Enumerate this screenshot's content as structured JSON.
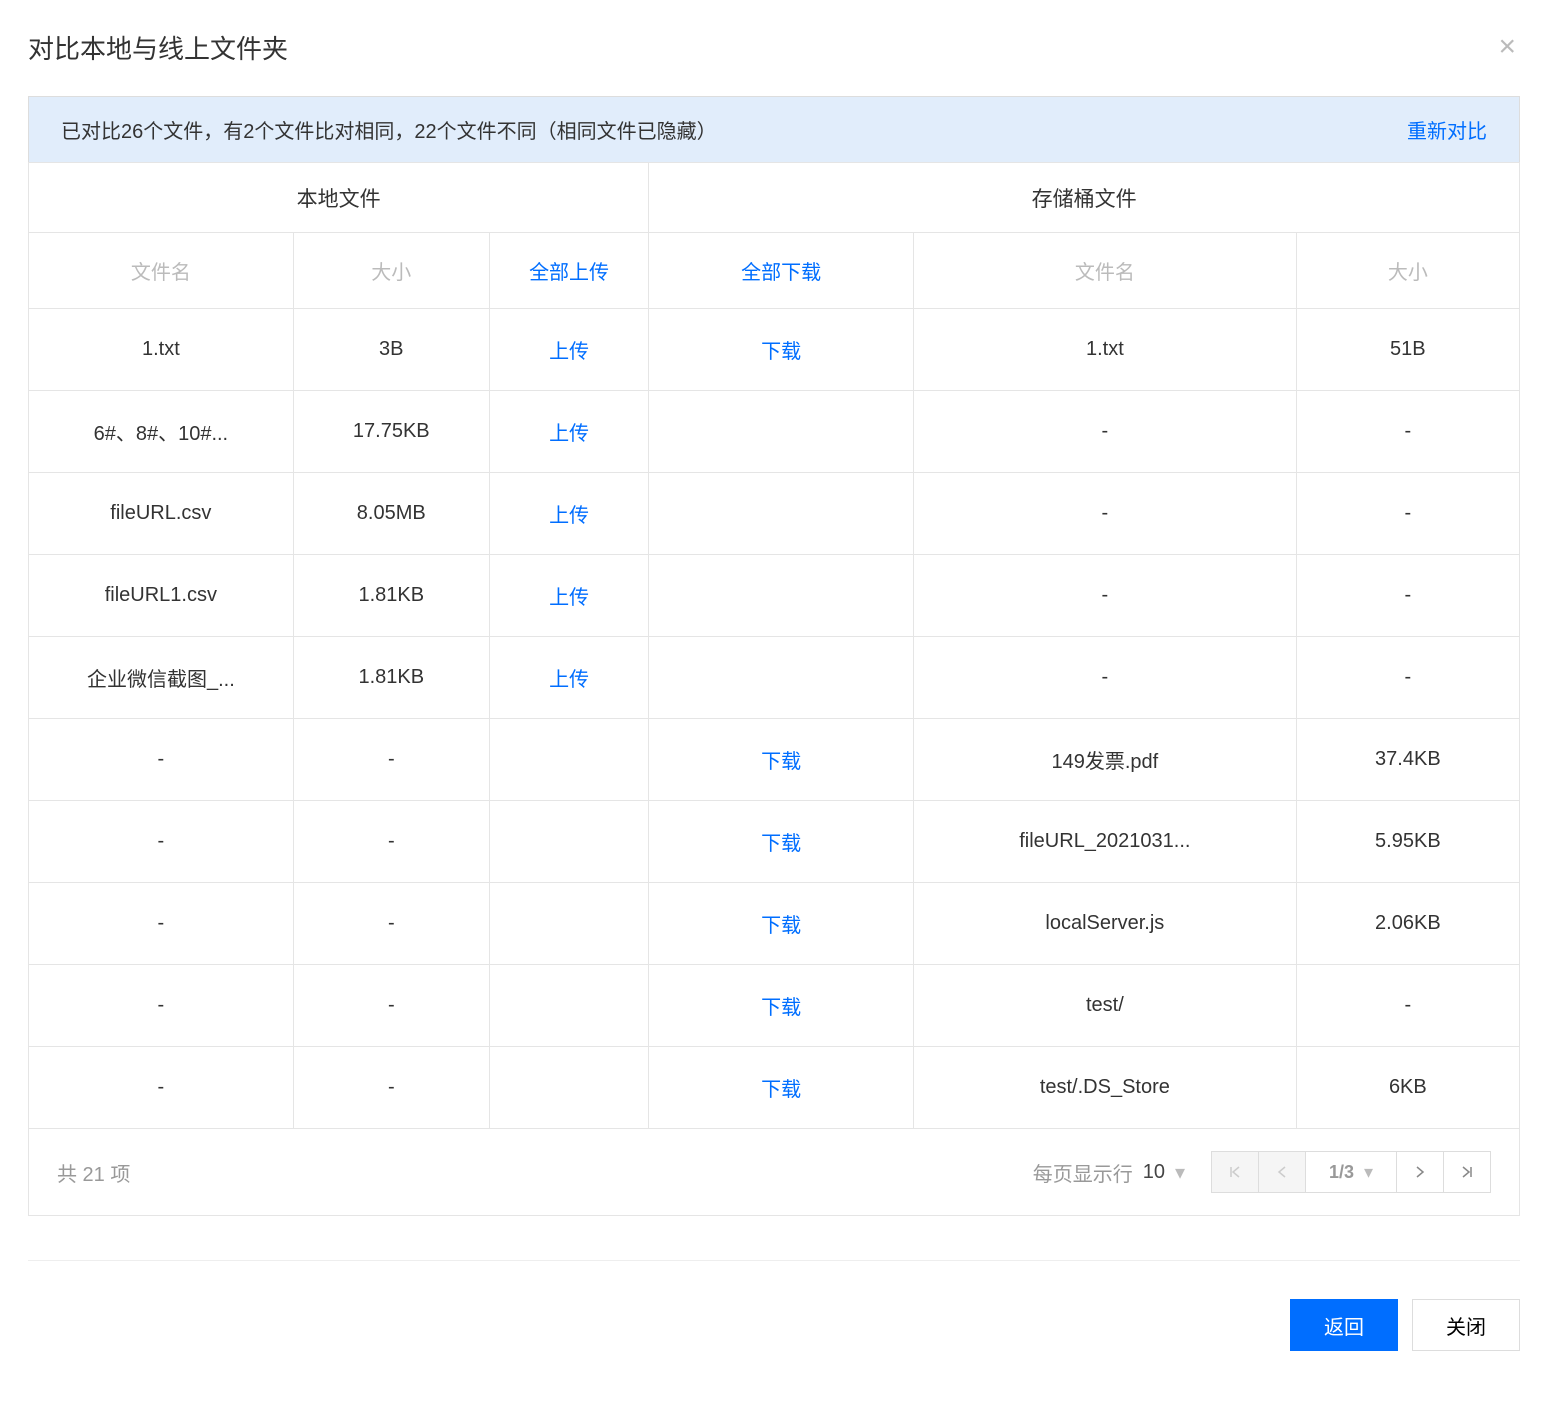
{
  "dialog": {
    "title": "对比本地与线上文件夹",
    "close_icon": "×"
  },
  "summary": {
    "text": "已对比26个文件，有2个文件比对相同，22个文件不同（相同文件已隐藏）",
    "refresh_label": "重新对比"
  },
  "columns": {
    "local_group": "本地文件",
    "bucket_group": "存储桶文件",
    "filename": "文件名",
    "size": "大小",
    "upload_all": "全部上传",
    "download_all": "全部下载"
  },
  "actions": {
    "upload": "上传",
    "download": "下载",
    "back": "返回",
    "close": "关闭"
  },
  "rows": [
    {
      "local_name": "1.txt",
      "local_size": "3B",
      "upload": true,
      "download": true,
      "bucket_name": "1.txt",
      "bucket_size": "51B"
    },
    {
      "local_name": "6#、8#、10#...",
      "local_size": "17.75KB",
      "upload": true,
      "download": false,
      "bucket_name": "-",
      "bucket_size": "-"
    },
    {
      "local_name": "fileURL.csv",
      "local_size": "8.05MB",
      "upload": true,
      "download": false,
      "bucket_name": "-",
      "bucket_size": "-"
    },
    {
      "local_name": "fileURL1.csv",
      "local_size": "1.81KB",
      "upload": true,
      "download": false,
      "bucket_name": "-",
      "bucket_size": "-"
    },
    {
      "local_name": "企业微信截图_...",
      "local_size": "1.81KB",
      "upload": true,
      "download": false,
      "bucket_name": "-",
      "bucket_size": "-"
    },
    {
      "local_name": "-",
      "local_size": "-",
      "upload": false,
      "download": true,
      "bucket_name": "149发票.pdf",
      "bucket_size": "37.4KB"
    },
    {
      "local_name": "-",
      "local_size": "-",
      "upload": false,
      "download": true,
      "bucket_name": "fileURL_2021031...",
      "bucket_size": "5.95KB"
    },
    {
      "local_name": "-",
      "local_size": "-",
      "upload": false,
      "download": true,
      "bucket_name": "localServer.js",
      "bucket_size": "2.06KB"
    },
    {
      "local_name": "-",
      "local_size": "-",
      "upload": false,
      "download": true,
      "bucket_name": "test/",
      "bucket_size": "-"
    },
    {
      "local_name": "-",
      "local_size": "-",
      "upload": false,
      "download": true,
      "bucket_name": "test/.DS_Store",
      "bucket_size": "6KB"
    }
  ],
  "footer": {
    "total_text": "共 21 项",
    "rows_per_page_label": "每页显示行",
    "rows_per_page_value": "10",
    "page_indicator": "1/3"
  }
}
